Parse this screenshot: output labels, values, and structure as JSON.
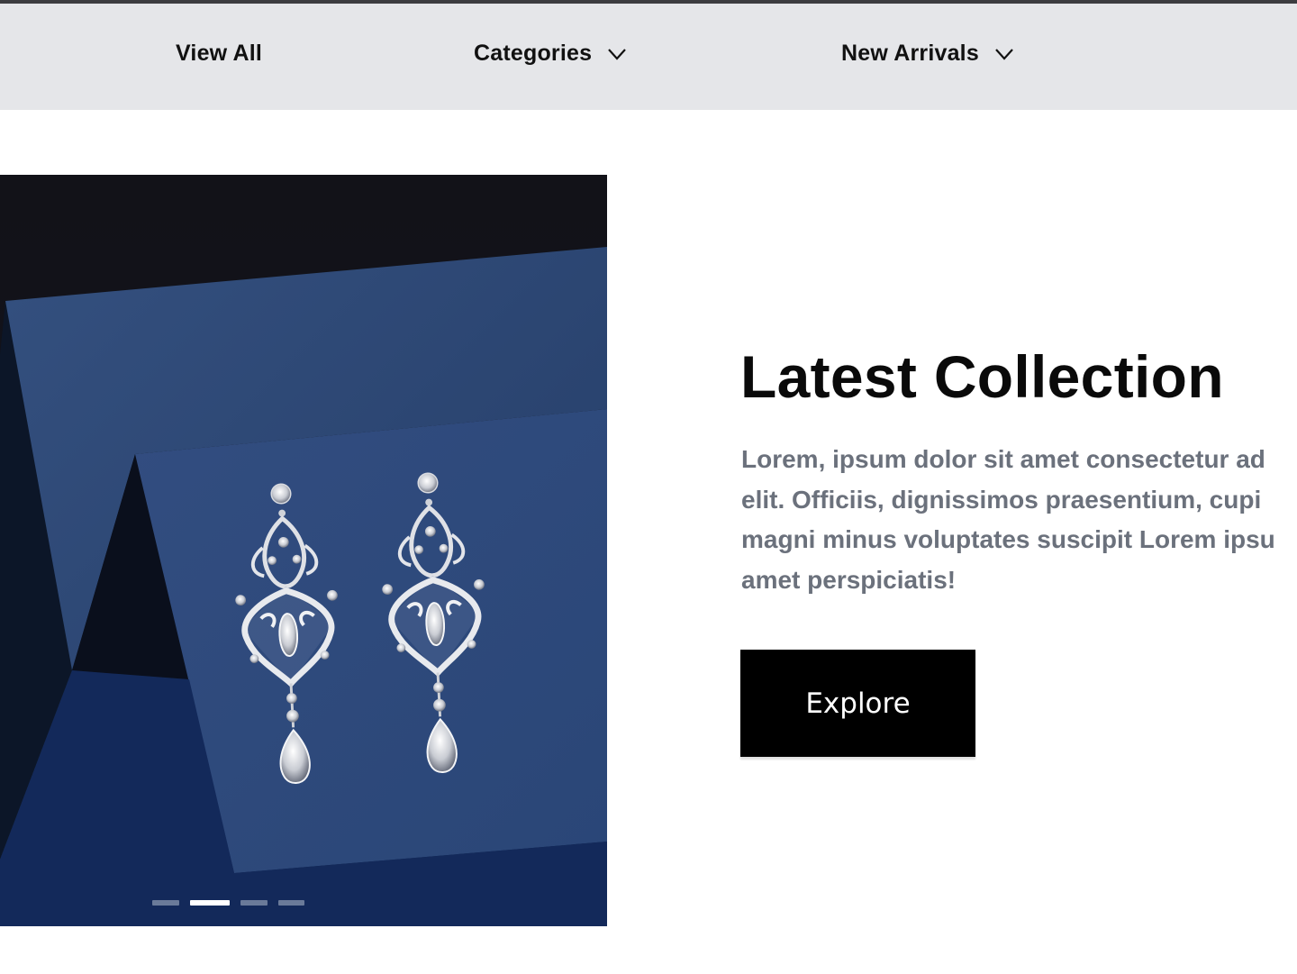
{
  "nav": {
    "items": [
      {
        "label": "View All",
        "has_dropdown": false
      },
      {
        "label": "Categories",
        "has_dropdown": true,
        "icon": "chevron-down-icon"
      },
      {
        "label": "New Arrivals",
        "has_dropdown": true,
        "icon": "chevron-down-icon"
      }
    ]
  },
  "hero": {
    "image_alt": "Crystal chandelier earrings on blue folded paper",
    "carousel": {
      "slide_count": 4,
      "active_index": 1
    },
    "title": "Latest Collection",
    "text_lines": [
      "Lorem, ipsum dolor sit amet consectetur ad",
      "elit. Officiis, dignissimos praesentium, cupi",
      "magni minus voluptates suscipit Lorem ipsu",
      "amet perspiciatis!"
    ],
    "button_label": "Explore"
  },
  "colors": {
    "nav_background": "#e5e6e9",
    "top_border": "#3c3c40",
    "text_muted": "#6b717c",
    "button_background": "#000000",
    "image_blue": "#2f4a7c"
  }
}
